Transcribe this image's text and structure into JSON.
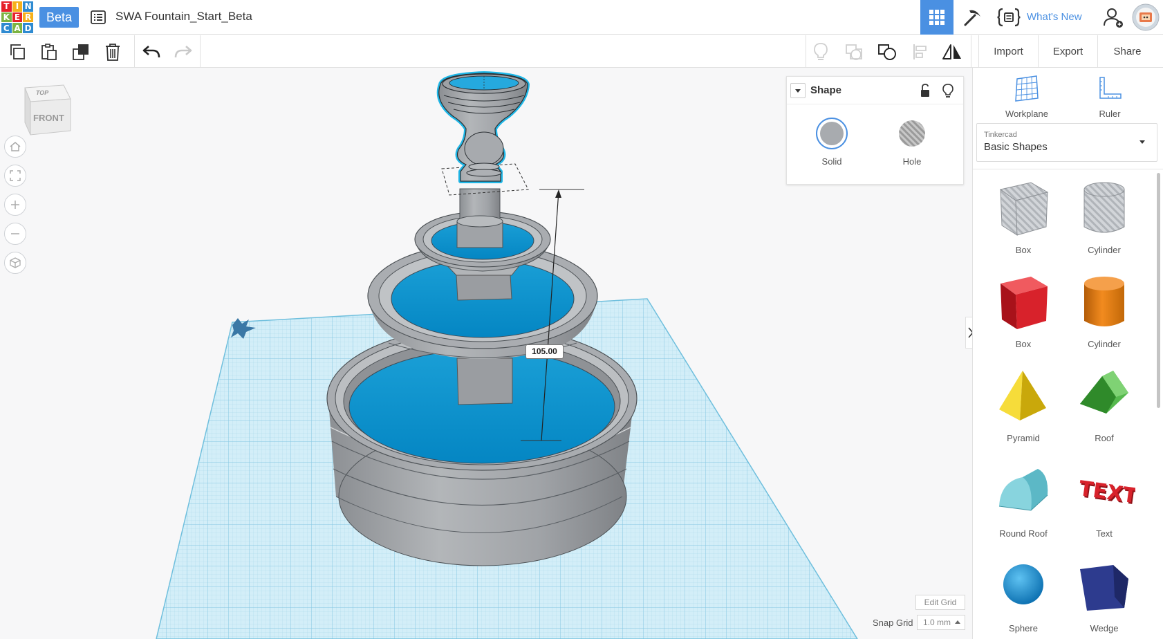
{
  "brand": {
    "logo_letters": [
      "T",
      "I",
      "N",
      "K",
      "E",
      "R",
      "C",
      "A",
      "D"
    ],
    "logo_colors": [
      "#e62129",
      "#f6b01b",
      "#2f8bd1",
      "#7cb342",
      "#e62129",
      "#f6b01b",
      "#2f8bd1",
      "#7cb342",
      "#2f8bd1"
    ],
    "beta_label": "Beta",
    "accent": "#4a90e2"
  },
  "document": {
    "title": "SWA Fountain_Start_Beta"
  },
  "header_actions": {
    "whats_new": "What's New",
    "icons": [
      "grid-view-icon",
      "pickaxe-icon",
      "code-blocks-icon",
      "add-user-icon",
      "profile-avatar"
    ]
  },
  "toolbar": {
    "left_icons": [
      "copy-icon",
      "paste-icon",
      "duplicate-icon",
      "delete-icon",
      "undo-icon",
      "redo-icon"
    ],
    "right_icons": [
      "light-bulb-icon",
      "group-icon",
      "ungroup-icon",
      "align-icon",
      "mirror-icon"
    ],
    "import_label": "Import",
    "export_label": "Export",
    "share_label": "Share"
  },
  "viewcube": {
    "top_label": "TOP",
    "front_label": "FRONT"
  },
  "nav_controls": [
    "home-view-icon",
    "fit-view-icon",
    "zoom-in-icon",
    "zoom-out-icon",
    "perspective-icon"
  ],
  "inspector": {
    "title": "Shape",
    "solid_label": "Solid",
    "hole_label": "Hole",
    "solid_color": "#a8abaf"
  },
  "measure": {
    "height_value": "105.00"
  },
  "grid_controls": {
    "edit_grid_label": "Edit Grid",
    "snap_grid_label": "Snap Grid",
    "snap_grid_value": "1.0 mm"
  },
  "side_panel": {
    "workplane_label": "Workplane",
    "ruler_label": "Ruler",
    "library_provider": "Tinkercad",
    "library_name": "Basic Shapes",
    "shapes": [
      {
        "label": "Box",
        "icon": "hole-box-icon"
      },
      {
        "label": "Cylinder",
        "icon": "hole-cylinder-icon"
      },
      {
        "label": "Box",
        "icon": "box-icon",
        "color": "#d8222b"
      },
      {
        "label": "Cylinder",
        "icon": "cylinder-icon",
        "color": "#e87a10"
      },
      {
        "label": "Pyramid",
        "icon": "pyramid-icon",
        "color": "#f2d21a"
      },
      {
        "label": "Roof",
        "icon": "roof-icon",
        "color": "#3fa63b"
      },
      {
        "label": "Round Roof",
        "icon": "round-roof-icon",
        "color": "#66c2cf"
      },
      {
        "label": "Text",
        "icon": "text-shape-icon",
        "color": "#d8222b"
      },
      {
        "label": "Sphere",
        "icon": "sphere-icon",
        "color": "#1e8fd2"
      },
      {
        "label": "Wedge",
        "icon": "wedge-icon",
        "color": "#28357f"
      }
    ]
  },
  "scene_colors": {
    "water": "#0b95d0",
    "stone": "#a4a7ab",
    "selection": "#1fb6e6",
    "workplane": "#bfe5f3"
  }
}
